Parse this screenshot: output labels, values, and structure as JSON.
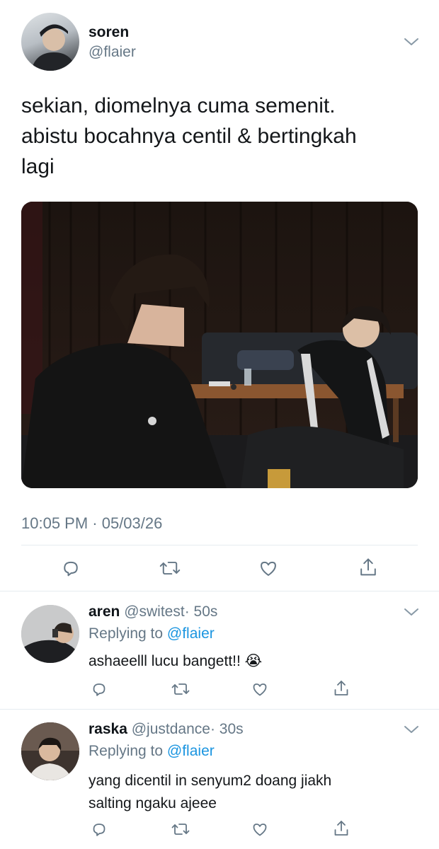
{
  "main_tweet": {
    "display_name": "soren",
    "handle": "@flaier",
    "text_lines": [
      "sekian, diomelnya cuma semenit.",
      "abistu bocahnya centil & bertingkah",
      "lagi"
    ],
    "timestamp": "10:05 PM · 05/03/26",
    "actions": [
      "reply-icon",
      "retweet-icon",
      "like-icon",
      "share-icon"
    ]
  },
  "replies": [
    {
      "display_name": "aren",
      "handle": "@switest",
      "time": "· 50s",
      "replying_prefix": "Replying to",
      "replying_handle": "@flaier",
      "text_lines": [
        "ashaeelll lucu bangett!! 😭"
      ]
    },
    {
      "display_name": "raska",
      "handle": "@justdance",
      "time": "· 30s",
      "replying_prefix": "Replying to",
      "replying_handle": "@flaier",
      "text_lines": [
        "yang dicentil in senyum2 doang jiakh",
        "salting ngaku ajeee"
      ]
    }
  ],
  "colors": {
    "link": "#1b95e0",
    "muted": "#657786",
    "text": "#14171a",
    "icon": "#657786"
  }
}
